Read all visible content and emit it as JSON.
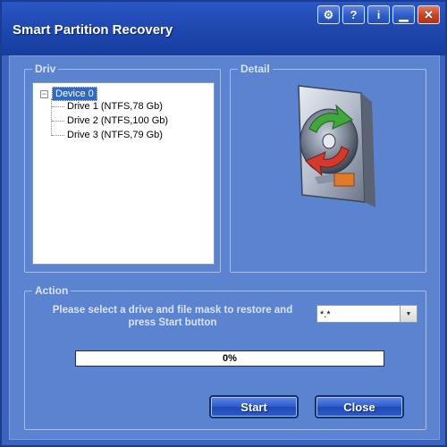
{
  "window": {
    "title": "Smart Partition Recovery",
    "controls": [
      {
        "name": "settings-icon",
        "glyph": "⚙"
      },
      {
        "name": "help-icon",
        "glyph": "?"
      },
      {
        "name": "info-icon",
        "glyph": "i"
      },
      {
        "name": "minimize-icon",
        "glyph": "▁"
      },
      {
        "name": "close-icon",
        "glyph": "✕"
      }
    ]
  },
  "drive_group": {
    "legend": "Driv",
    "tree": {
      "toggle": "−",
      "root": "Device 0",
      "children": [
        "Drive 1 (NTFS,78 Gb)",
        "Drive 2 (NTFS,100 Gb)",
        "Drive 3 (NTFS,79 Gb)"
      ]
    }
  },
  "detail_group": {
    "legend": "Detail",
    "icon": "hard-drive-recovery-icon"
  },
  "action_group": {
    "legend": "Action",
    "message": "Please select a drive and file mask to restore and press Start button",
    "file_mask": "*.*",
    "progress_label": "0%",
    "progress_value": 0
  },
  "buttons": {
    "start": "Start",
    "close": "Close"
  },
  "colors": {
    "window_bg": "#3d63bd",
    "panel_bg": "#5b83cf",
    "accent": "#316ac5"
  }
}
